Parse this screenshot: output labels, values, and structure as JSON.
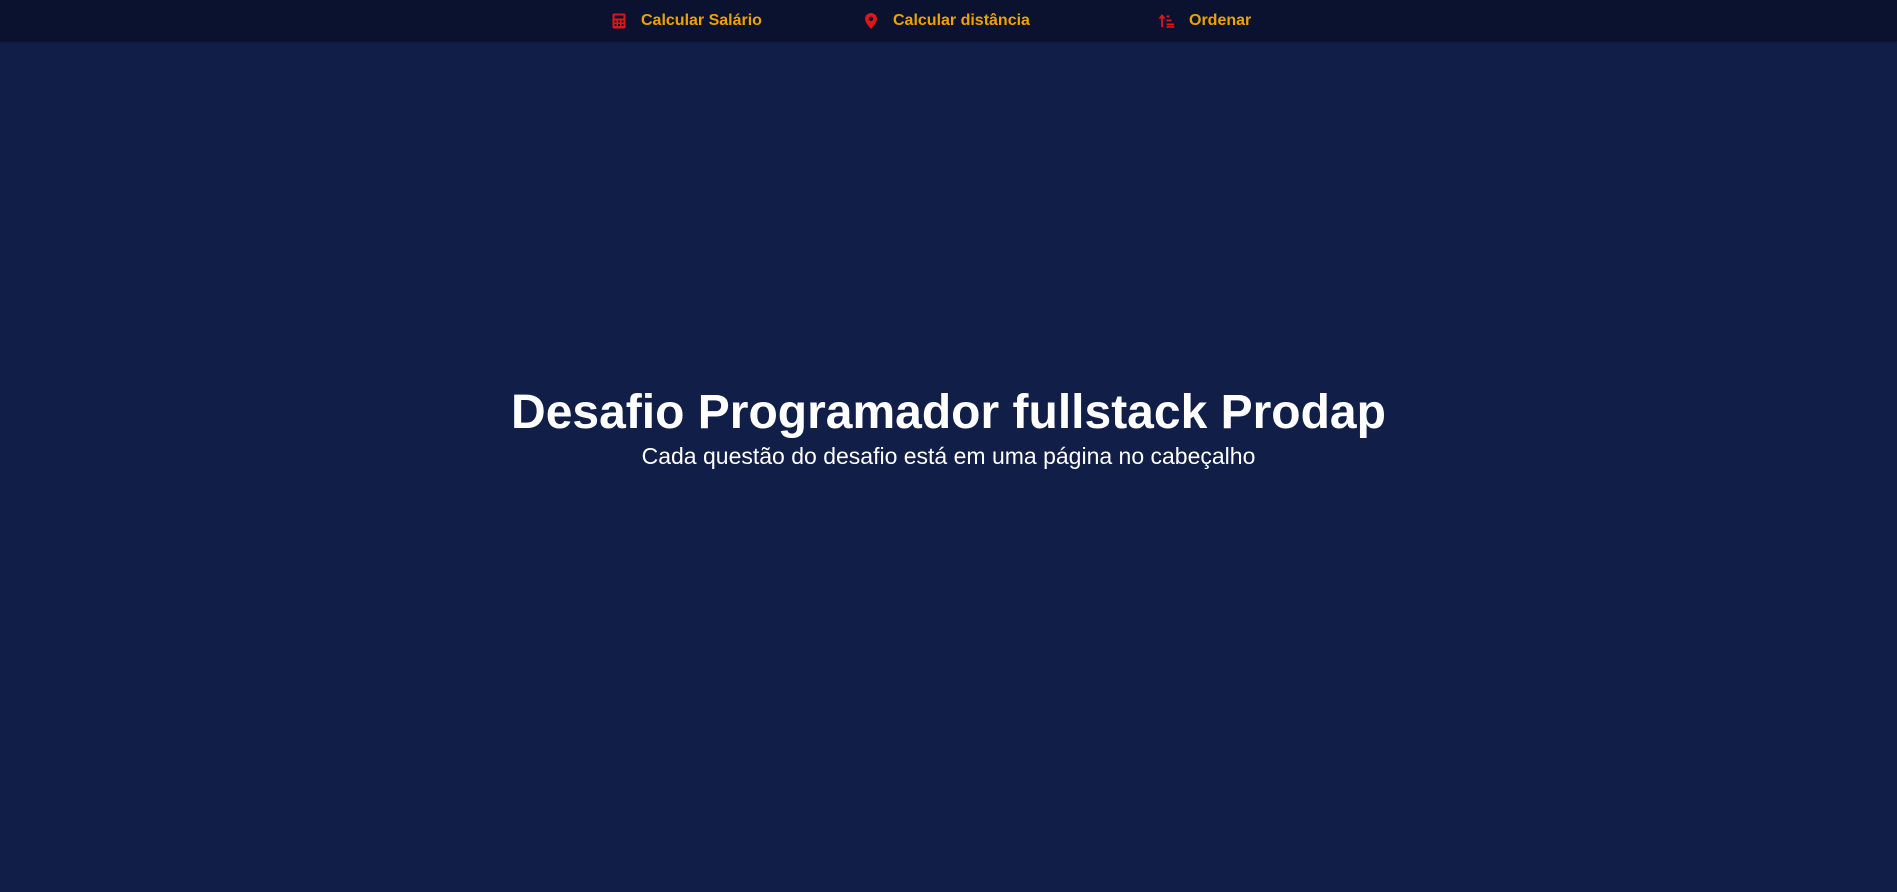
{
  "nav": {
    "items": [
      {
        "label": "Calcular Salário",
        "icon": "calculator-icon"
      },
      {
        "label": "Calcular distância",
        "icon": "map-pin-icon"
      },
      {
        "label": "Ordenar",
        "icon": "sort-ascending-icon"
      }
    ]
  },
  "hero": {
    "title": "Desafio Programador fullstack Prodap",
    "subtitle": "Cada questão do desafio está em uma página no cabeçalho"
  },
  "colors": {
    "background": "#111e48",
    "header_background": "#0b1230",
    "nav_label": "#f0a000",
    "nav_icon": "#e01515",
    "text": "#ffffff"
  }
}
